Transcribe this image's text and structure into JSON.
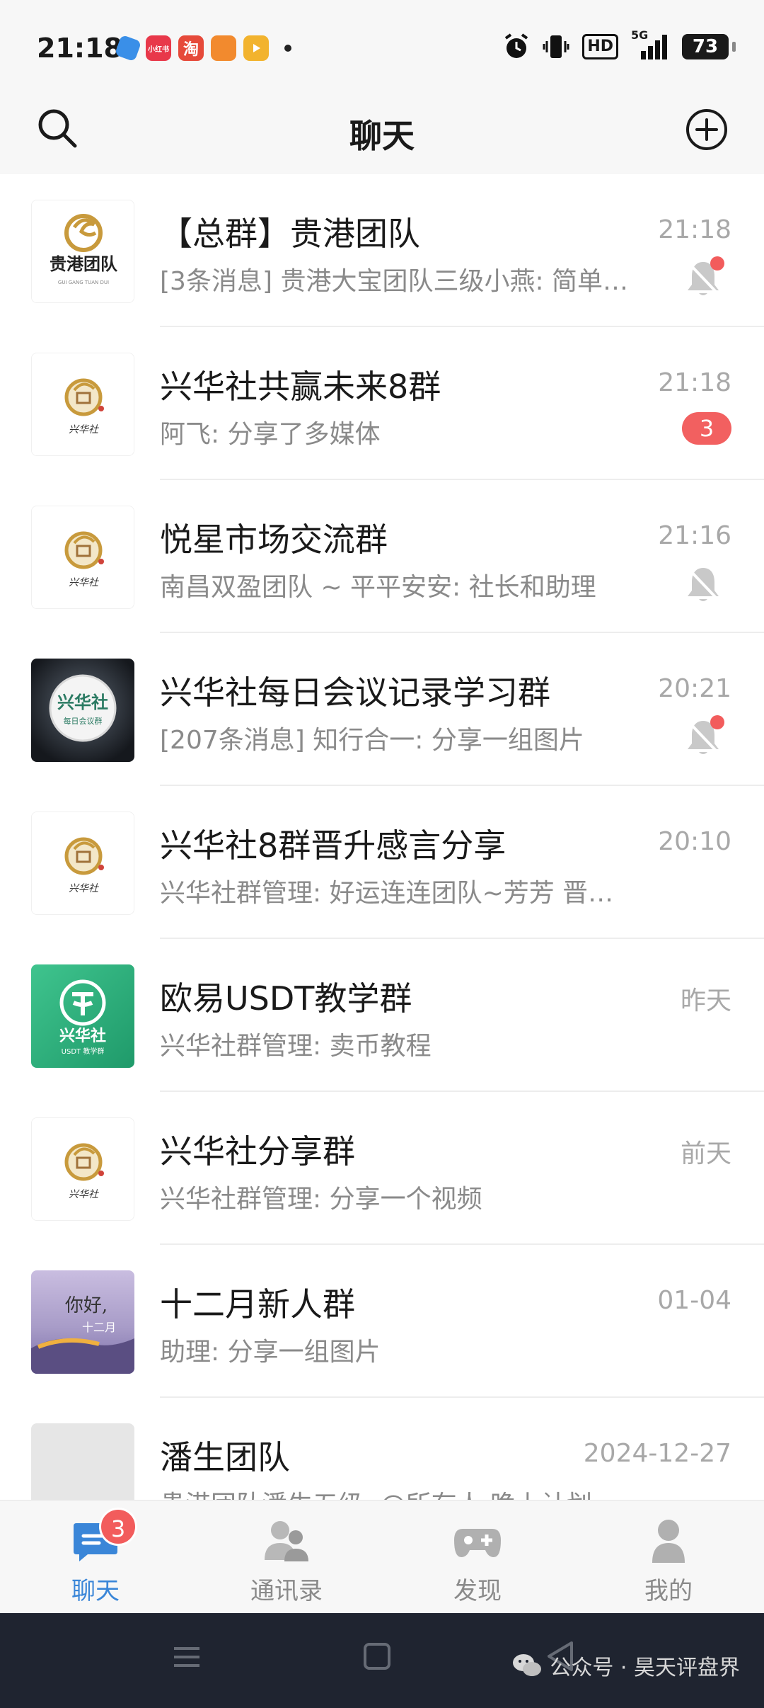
{
  "status_bar": {
    "time": "21:18",
    "app_icons": [
      {
        "name": "app-blue-icon",
        "label": "",
        "color": "#3a8fe8"
      },
      {
        "name": "xiaohongshu-icon",
        "label": "小红书",
        "color": "#e8384a"
      },
      {
        "name": "taobao-icon",
        "label": "淘",
        "color": "#e64a3a"
      },
      {
        "name": "app-orange-icon",
        "label": "",
        "color": "#f28a2e"
      },
      {
        "name": "video-app-icon",
        "label": "",
        "color": "#f2b32e"
      }
    ],
    "network": "5G",
    "hd_label": "HD",
    "battery": "73"
  },
  "header": {
    "title": "聊天"
  },
  "chats": [
    {
      "name": "【总群】贵港团队",
      "message": "[3条消息] 贵港大宝团队三级小燕: 简单…",
      "time": "21:18",
      "muted": true,
      "red_dot": true,
      "unread": "",
      "avatar": "guigang"
    },
    {
      "name": "兴华社共赢未来8群",
      "message": "阿飞: 分享了多媒体",
      "time": "21:18",
      "muted": false,
      "red_dot": false,
      "unread": "3",
      "avatar": "xinghua"
    },
    {
      "name": "悦星市场交流群",
      "message": "南昌双盈团队 ~ 平平安安: 社长和助理",
      "time": "21:16",
      "muted": true,
      "red_dot": false,
      "unread": "",
      "avatar": "xinghua"
    },
    {
      "name": "兴华社每日会议记录学习群",
      "message": "[207条消息] 知行合一: 分享一组图片",
      "time": "20:21",
      "muted": true,
      "red_dot": true,
      "unread": "",
      "avatar": "meeting"
    },
    {
      "name": "兴华社8群晋升感言分享",
      "message": "兴华社群管理: 好运连连团队~芳芳 晋…",
      "time": "20:10",
      "muted": false,
      "red_dot": false,
      "unread": "",
      "avatar": "xinghua"
    },
    {
      "name": "欧易USDT教学群",
      "message": "兴华社群管理: 卖币教程",
      "time": "昨天",
      "muted": false,
      "red_dot": false,
      "unread": "",
      "avatar": "usdt"
    },
    {
      "name": "兴华社分享群",
      "message": "兴华社群管理: 分享一个视频",
      "time": "前天",
      "muted": false,
      "red_dot": false,
      "unread": "",
      "avatar": "xinghua"
    },
    {
      "name": "十二月新人群",
      "message": "助理: 分享一组图片",
      "time": "01-04",
      "muted": false,
      "red_dot": false,
      "unread": "",
      "avatar": "december"
    },
    {
      "name": "潘生团队",
      "message": "贵港团队潘生五级: @所有人 晚上计划",
      "time": "2024-12-27",
      "muted": false,
      "red_dot": false,
      "unread": "",
      "avatar": "blank"
    }
  ],
  "avatar_text": {
    "guigang_title": "贵港团队",
    "guigang_sub": "GUI GANG TUAN DUI",
    "xinghua_seal": "兴华社",
    "meeting_title": "兴华社",
    "meeting_sub": "每日会议群",
    "usdt_title": "兴华社",
    "usdt_sub": "USDT 教学群",
    "december_greeting": "你好,",
    "december_month": "十二月"
  },
  "tabs": [
    {
      "label": "聊天",
      "active": true,
      "badge": "3",
      "icon": "chat-icon"
    },
    {
      "label": "通讯录",
      "active": false,
      "badge": "",
      "icon": "contacts-icon"
    },
    {
      "label": "发现",
      "active": false,
      "badge": "",
      "icon": "gamepad-icon"
    },
    {
      "label": "我的",
      "active": false,
      "badge": "",
      "icon": "profile-icon"
    }
  ],
  "watermark": "公众号 · 昊天评盘界",
  "colors": {
    "accent": "#3a86d8",
    "badge": "#f25c5c"
  }
}
